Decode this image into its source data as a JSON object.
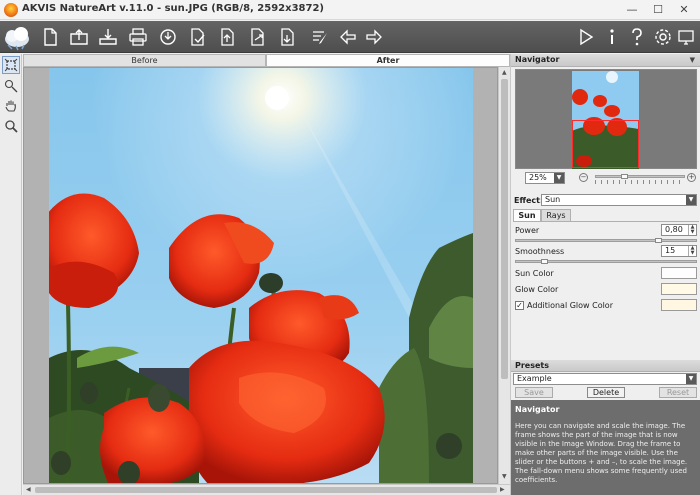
{
  "window": {
    "title": "AKVIS NatureArt v.11.0 - sun.JPG (RGB/8, 2592x3872)",
    "minimize": "—",
    "maximize": "☐",
    "close": "✕"
  },
  "toolbar": {
    "icons": [
      "new-file-icon",
      "open-file-icon",
      "save-file-icon",
      "print-icon",
      "share-icon",
      "batch-processing-icon",
      "upload-icon",
      "share-export-icon",
      "export-icon",
      "preferences-brush-icon",
      "undo-arrow-icon",
      "redo-arrow-icon",
      "run-play-icon",
      "info-icon",
      "help-icon",
      "settings-gear-icon"
    ]
  },
  "left_tools": [
    "crop-frame-icon",
    "eyedropper-brush-icon",
    "hand-pan-icon",
    "zoom-magnifier-icon"
  ],
  "view_tabs": {
    "before": "Before",
    "after": "After"
  },
  "navigator": {
    "title": "Navigator",
    "zoom": "25%",
    "zoom_out": "−",
    "zoom_in": "+"
  },
  "effect": {
    "label": "Effect:",
    "value": "Sun",
    "tabs": [
      "Sun",
      "Rays"
    ],
    "power_label": "Power",
    "power_value": "0,80",
    "power_fraction": 0.8,
    "smoothness_label": "Smoothness",
    "smoothness_value": "15",
    "smoothness_fraction": 0.15,
    "sun_color_label": "Sun Color",
    "glow_color_label": "Glow Color",
    "additional_glow_label": "Additional Glow Color",
    "additional_glow_checked": "✓",
    "colors": {
      "sun": "#fdfdfd",
      "glow": "#fff9e6",
      "additional_glow": "#fff7e2"
    }
  },
  "presets": {
    "title": "Presets",
    "value": "Example",
    "save": "Save",
    "delete": "Delete",
    "reset": "Reset"
  },
  "help": {
    "title": "Navigator",
    "text": "Here you can navigate and scale the image. The frame shows the part of the image that is now visible in the Image Window. Drag the frame to make other parts of the image visible. Use the slider or the buttons + and –, to scale the image. The fall-down menu shows some frequently used coefficients."
  }
}
